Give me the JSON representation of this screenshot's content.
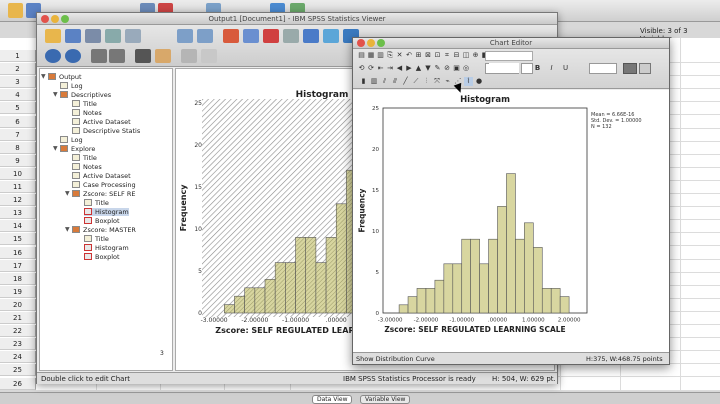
{
  "data_editor": {
    "visible_variables": "Visible: 3 of 3 Variables",
    "row_numbers": [
      "1",
      "2",
      "3",
      "4",
      "5",
      "6",
      "7",
      "8",
      "9",
      "10",
      "11",
      "12",
      "13",
      "14",
      "15",
      "16",
      "17",
      "18",
      "19",
      "20",
      "21",
      "22",
      "23",
      "24",
      "25",
      "26"
    ],
    "tabs": [
      "Data View",
      "Variable View"
    ]
  },
  "viewer": {
    "title": "Output1 [Document1] - IBM SPSS Statistics Viewer",
    "outline": [
      {
        "label": "Output",
        "level": 0,
        "icon": "book"
      },
      {
        "label": "Log",
        "level": 1,
        "icon": "page"
      },
      {
        "label": "Descriptives",
        "level": 1,
        "icon": "book"
      },
      {
        "label": "Title",
        "level": 2,
        "icon": "page"
      },
      {
        "label": "Notes",
        "level": 2,
        "icon": "page"
      },
      {
        "label": "Active Dataset",
        "level": 2,
        "icon": "page"
      },
      {
        "label": "Descriptive Statis",
        "level": 2,
        "icon": "page"
      },
      {
        "label": "Log",
        "level": 1,
        "icon": "page"
      },
      {
        "label": "Explore",
        "level": 1,
        "icon": "book"
      },
      {
        "label": "Title",
        "level": 2,
        "icon": "page"
      },
      {
        "label": "Notes",
        "level": 2,
        "icon": "page"
      },
      {
        "label": "Active Dataset",
        "level": 2,
        "icon": "page"
      },
      {
        "label": "Case Processing",
        "level": 2,
        "icon": "page"
      },
      {
        "label": "Zscore:  SELF RE",
        "level": 2,
        "icon": "book"
      },
      {
        "label": "Title",
        "level": 3,
        "icon": "page"
      },
      {
        "label": "Histogram",
        "level": 3,
        "icon": "chart",
        "selected": true
      },
      {
        "label": "Boxplot",
        "level": 3,
        "icon": "chart"
      },
      {
        "label": "Zscore:  MASTER",
        "level": 2,
        "icon": "book"
      },
      {
        "label": "Title",
        "level": 3,
        "icon": "page"
      },
      {
        "label": "Histogram",
        "level": 3,
        "icon": "chart"
      },
      {
        "label": "Boxplot",
        "level": 3,
        "icon": "chart"
      }
    ],
    "status_left": "Double click to edit Chart",
    "status_mid": "IBM SPSS Statistics Processor is ready",
    "status_right": "H: 504, W: 629 pt.",
    "page_marker": "3"
  },
  "editor": {
    "title": "Chart Editor",
    "status_left": "Show Distribution Curve",
    "status_right": "H:375, W:468.75 points"
  },
  "chart_data": [
    {
      "type": "bar",
      "title": "Histogram",
      "xlabel": "Zscore:  SELF REGULATED LEARNING SCALE",
      "ylabel": "Frequency",
      "stats": [
        "Mean = 6.66E-16",
        "Std. Dev. = 1.00000",
        "N = 132"
      ],
      "x_ticks": [
        "-3.00000",
        "-2.00000",
        "-1.00000",
        ".00000",
        "1.00000",
        "2.00000"
      ],
      "x_tick_values": [
        -3,
        -2,
        -1,
        0,
        1,
        2
      ],
      "y_ticks": [
        "0",
        "5",
        "10",
        "15",
        "20",
        "25"
      ],
      "ylim": [
        0,
        25
      ],
      "xlim": [
        -3.2,
        2.5
      ],
      "bin_edges": [
        -2.75,
        -2.5,
        -2.25,
        -2.0,
        -1.75,
        -1.5,
        -1.25,
        -1.0,
        -0.75,
        -0.5,
        -0.25,
        0.0,
        0.25,
        0.5,
        0.75,
        1.0,
        1.25,
        1.5,
        1.75,
        2.0
      ],
      "values": [
        1,
        2,
        3,
        3,
        4,
        6,
        6,
        9,
        9,
        6,
        9,
        13,
        17,
        9,
        11,
        8,
        3,
        3,
        2
      ],
      "grid": false
    }
  ]
}
